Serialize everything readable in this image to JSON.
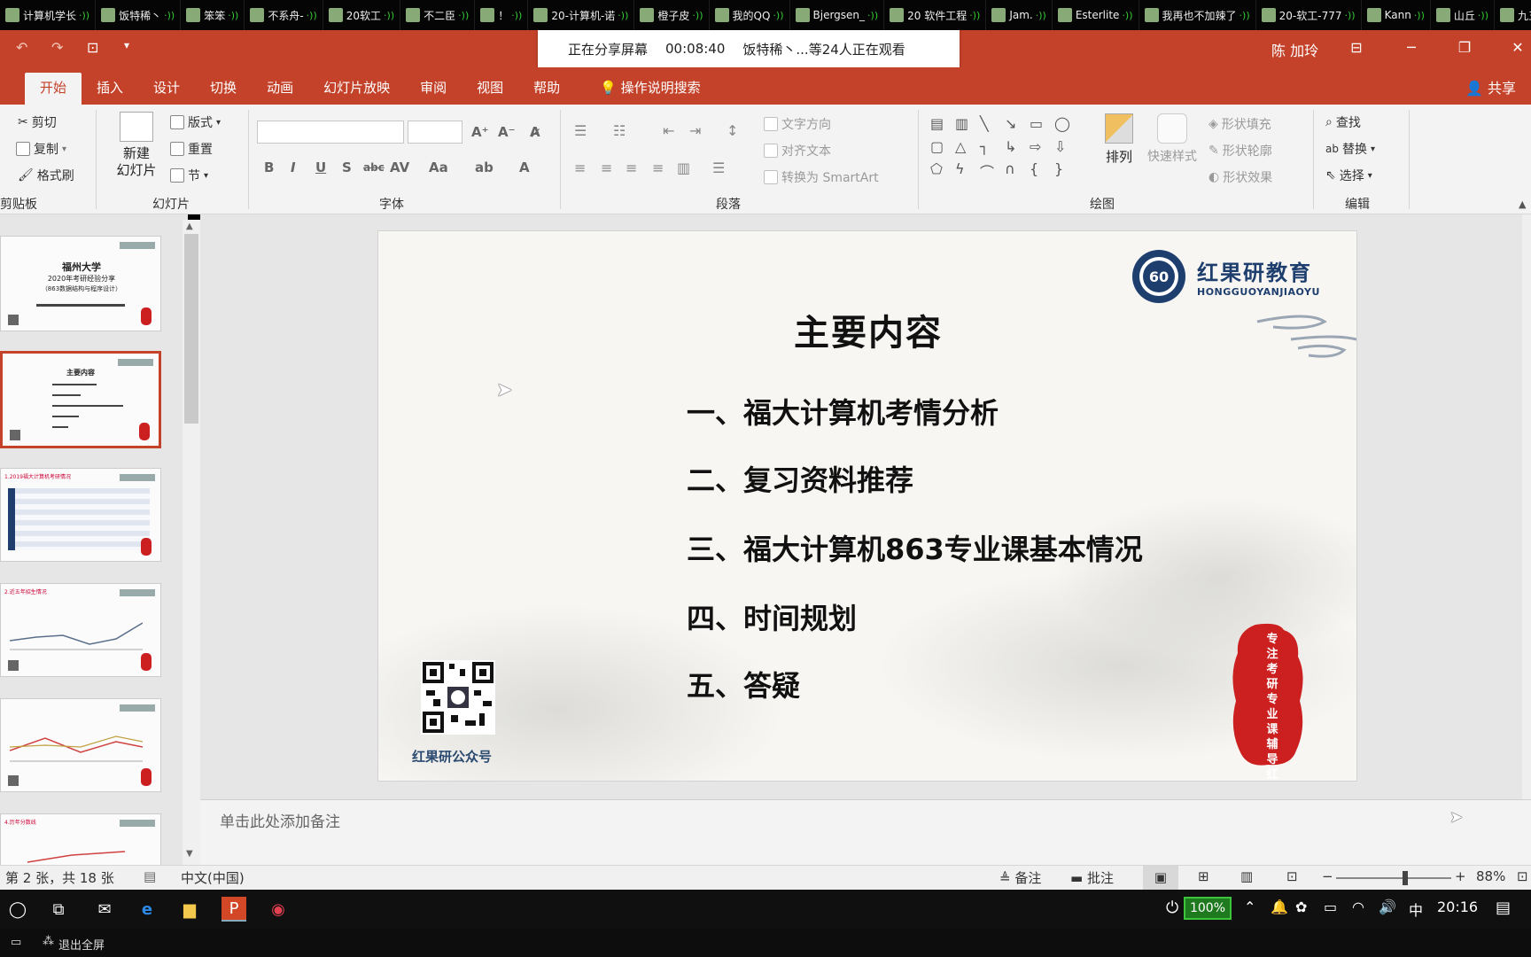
{
  "participants": [
    {
      "name": "计算机学长",
      "mic": true
    },
    {
      "name": "饭特稀丶",
      "mic": true
    },
    {
      "name": "笨笨",
      "mic": true
    },
    {
      "name": "不系舟-",
      "mic": true
    },
    {
      "name": "20软工",
      "mic": true
    },
    {
      "name": "不二臣",
      "mic": true
    },
    {
      "name": "！",
      "mic": true
    },
    {
      "name": "20-计算机-诺",
      "mic": true
    },
    {
      "name": "橙子皮",
      "mic": true
    },
    {
      "name": "我的QQ",
      "mic": true
    },
    {
      "name": "Bjergsen_",
      "mic": true
    },
    {
      "name": "20  软件工程",
      "mic": true
    },
    {
      "name": "Jam.",
      "mic": true
    },
    {
      "name": "Esterlite",
      "mic": true
    },
    {
      "name": "我再也不加辣了",
      "mic": true
    },
    {
      "name": "20-软工-777",
      "mic": true
    },
    {
      "name": "Kann",
      "mic": true
    },
    {
      "name": "山丘",
      "mic": true
    },
    {
      "name": "九五二七",
      "mic": false
    }
  ],
  "share_banner": {
    "status": "正在分享屏幕",
    "timer": "00:08:40",
    "viewers": "饭特稀丶...等24人正在观看"
  },
  "titlebar": {
    "user": "陈 加玲"
  },
  "tabs": [
    "开始",
    "插入",
    "设计",
    "切换",
    "动画",
    "幻灯片放映",
    "审阅",
    "视图",
    "帮助"
  ],
  "tell_me": "操作说明搜索",
  "share_label": "共享",
  "ribbon": {
    "clipboard": {
      "label": "剪贴板",
      "cut": "剪切",
      "copy": "复制",
      "painter": "格式刷"
    },
    "slides": {
      "label": "幻灯片",
      "new_slide": "新建\n幻灯片",
      "layout": "版式",
      "reset": "重置",
      "section": "节"
    },
    "font": {
      "label": "字体"
    },
    "paragraph": {
      "label": "段落",
      "text_direction": "文字方向",
      "align_text": "对齐文本",
      "smartart": "转换为 SmartArt"
    },
    "drawing": {
      "label": "绘图",
      "arrange": "排列",
      "quick_styles": "快速样式",
      "shape_fill": "形状填充",
      "shape_outline": "形状轮廓",
      "shape_effects": "形状效果"
    },
    "editing": {
      "label": "编辑",
      "find": "查找",
      "replace": "替换",
      "select": "选择"
    }
  },
  "slide": {
    "title": "主要内容",
    "items": [
      "一、福大计算机考情分析",
      "二、复习资料推荐",
      "三、福大计算机863专业课基本情况",
      "四、时间规划",
      "五、答疑"
    ],
    "brand_name": "红果研教育",
    "brand_pinyin": "HONGGUOYANJIAOYU",
    "qr_caption": "红果研公众号",
    "seal_text": "专注考研专业课辅导红果研教育"
  },
  "thumb1": {
    "title": "福州大学",
    "sub1": "2020年考研经验分享",
    "sub2": "（863数据结构与程序设计）"
  },
  "thumb2": {
    "title": "主要内容"
  },
  "thumb3": {
    "title": "1.2019福大计算机考研情况"
  },
  "thumb4": {
    "title": "2.近五年招生情况"
  },
  "thumb6": {
    "title": "4.历年分数线"
  },
  "notes_placeholder": "单击此处添加备注",
  "statusbar": {
    "slide_info": "第 2 张，共 18 张",
    "language": "中文(中国)",
    "notes": "备注",
    "comments": "批注",
    "zoom": "88%",
    "zoom_fraction": 0.6
  },
  "taskbar": {
    "battery": "100%",
    "ime": "中",
    "time": "20:16"
  },
  "exit_fullscreen": "退出全屏",
  "colors": {
    "accent": "#c4422a",
    "brand": "#1e3f6e",
    "seal": "#cc2020"
  }
}
